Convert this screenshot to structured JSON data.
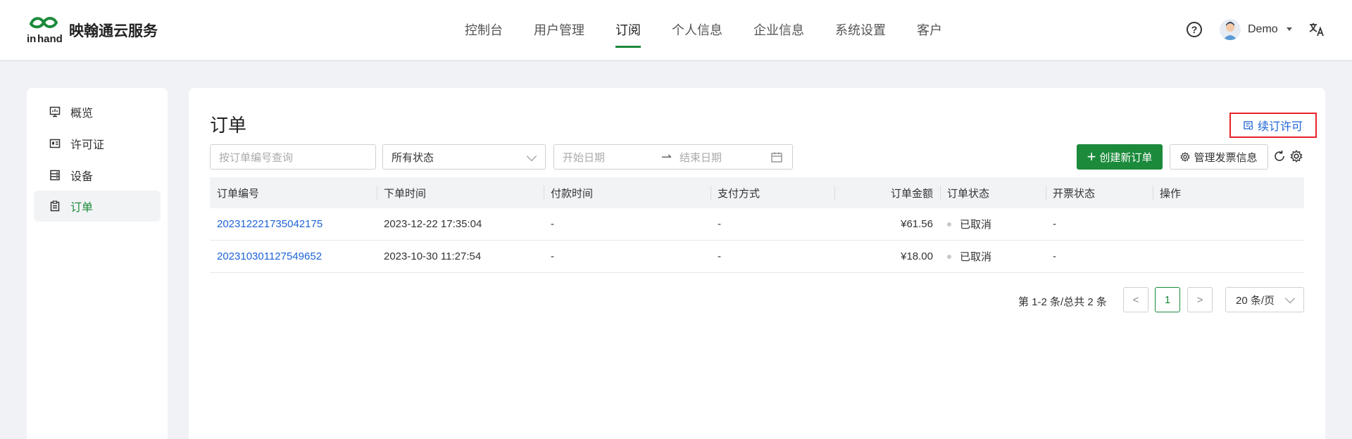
{
  "header": {
    "brand": "映翰通云服务",
    "nav": [
      "控制台",
      "用户管理",
      "订阅",
      "个人信息",
      "企业信息",
      "系统设置",
      "客户"
    ],
    "active_nav": "订阅",
    "help": "?",
    "user": "Demo"
  },
  "sidebar": {
    "items": [
      {
        "label": "概览",
        "icon": "monitor-icon"
      },
      {
        "label": "许可证",
        "icon": "license-icon"
      },
      {
        "label": "设备",
        "icon": "device-icon"
      },
      {
        "label": "订单",
        "icon": "order-icon"
      }
    ],
    "active": "订单"
  },
  "main": {
    "title": "订单",
    "renew_label": "续订许可",
    "search_placeholder": "按订单编号查询",
    "status_select": "所有状态",
    "date_start_placeholder": "开始日期",
    "date_end_placeholder": "结束日期",
    "date_separator": "⇀",
    "create_button": "创建新订单",
    "create_plus": "+",
    "invoice_button": "管理发票信息"
  },
  "table": {
    "columns": [
      "订单编号",
      "下单时间",
      "付款时间",
      "支付方式",
      "订单金额",
      "订单状态",
      "开票状态",
      "操作"
    ],
    "rows": [
      {
        "order_no": "202312221735042175",
        "order_time": "2023-12-22 17:35:04",
        "pay_time": "-",
        "pay_method": "-",
        "amount": "¥61.56",
        "status": "已取消",
        "invoice_status": "-",
        "action": ""
      },
      {
        "order_no": "202310301127549652",
        "order_time": "2023-10-30 11:27:54",
        "pay_time": "-",
        "pay_method": "-",
        "amount": "¥18.00",
        "status": "已取消",
        "invoice_status": "-",
        "action": ""
      }
    ]
  },
  "pagination": {
    "summary": "第 1-2 条/总共 2 条",
    "prev": "<",
    "current_page": "1",
    "next": ">",
    "page_size": "20 条/页"
  },
  "colors": {
    "accent": "#1b8a3b",
    "link": "#1c62d6",
    "highlight_border": "#e8222a"
  }
}
